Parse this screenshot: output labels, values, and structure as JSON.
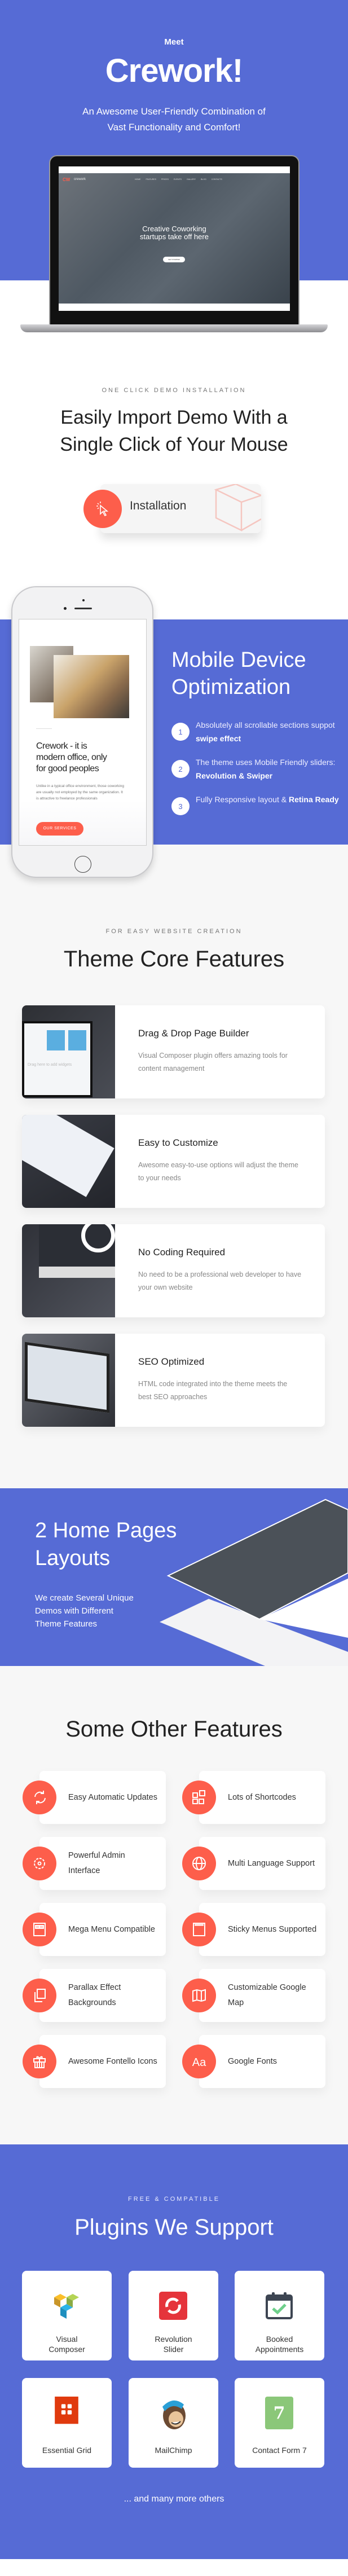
{
  "colors": {
    "brand_blue": "#566bd5",
    "accent_coral": "#fd5e4b",
    "section_gray": "#f7f7f7"
  },
  "hero": {
    "meet": "Meet",
    "title": "Crework!",
    "subtitle_lines": [
      "An Awesome User-Friendly Combination of",
      "Vast Functionality and Comfort!"
    ],
    "laptop_screen": {
      "logo_mark": "CW",
      "logo_text": "crework",
      "nav": [
        "HOME",
        "FEATURES",
        "PRICES",
        "EVENTS",
        "GALLERY",
        "BLOG",
        "CONTACTS"
      ],
      "headline_lines": [
        "Creative Coworking",
        "startups take off here"
      ],
      "cta": "GET STARTED"
    }
  },
  "demo": {
    "eyebrow": "ONE CLICK DEMO INSTALLATION",
    "title_lines": [
      "Easily Import Demo With a",
      "Single Click of Your Mouse"
    ],
    "button_label": "Installation",
    "button_icon": "cursor-click-icon"
  },
  "mobile": {
    "phone": {
      "heading_lines": [
        "Crework - it is",
        "modern office, only",
        "for good peoples"
      ],
      "body": "Unlike in a typical office environment, those coworking are usually not employed by the same organization. It is attractive to freelance professionals",
      "button": "OUR SERVICES"
    },
    "title_lines": [
      "Mobile Device",
      "Optimization"
    ],
    "items": [
      {
        "num": "1",
        "text": "Absolutely all scrollable sections suppot ",
        "bold": "swipe effect"
      },
      {
        "num": "2",
        "text": "The theme uses Mobile Friendly sliders: ",
        "bold": "Revolution & Swiper"
      },
      {
        "num": "3",
        "text": "Fully Responsive layout & ",
        "bold": "Retina Ready"
      }
    ]
  },
  "core": {
    "eyebrow": "FOR EASY WEBSITE CREATION",
    "title": "Theme Core Features",
    "cards": [
      {
        "title": "Drag & Drop Page Builder",
        "desc": "Visual Composer plugin offers amazing tools for content management",
        "image_caption": "Drag here to add widgets"
      },
      {
        "title": "Easy to Customize",
        "desc": "Awesome easy-to-use options will adjust the theme to your needs"
      },
      {
        "title": "No Coding Required",
        "desc": "No need to be a professional web developer to have your own website"
      },
      {
        "title": "SEO Optimized",
        "desc": "HTML code integrated into the theme meets the best SEO approaches"
      }
    ]
  },
  "layouts": {
    "title_lines": [
      "2 Home Pages",
      "Layouts"
    ],
    "desc_lines": [
      "We create Several Unique",
      "Demos with Different",
      "Theme Features"
    ]
  },
  "other": {
    "title": "Some Other Features",
    "items": [
      {
        "label": "Easy Automatic Updates",
        "icon": "refresh-icon"
      },
      {
        "label": "Lots of Shortcodes",
        "icon": "shortcodes-grid-icon"
      },
      {
        "label": "Powerful Admin Interface",
        "icon": "gear-icon"
      },
      {
        "label": "Multi Language Support",
        "icon": "globe-icon"
      },
      {
        "label": "Mega Menu Compatible",
        "icon": "mega-menu-icon"
      },
      {
        "label": "Sticky Menus Supported",
        "icon": "sticky-menu-icon"
      },
      {
        "label": "Parallax Effect Backgrounds",
        "icon": "layers-icon"
      },
      {
        "label": "Customizable Google Map",
        "icon": "map-icon"
      },
      {
        "label": "Awesome Fontello Icons",
        "icon": "gift-icon"
      },
      {
        "label": "Google Fonts",
        "icon": "font-aa-icon"
      }
    ]
  },
  "plugins": {
    "eyebrow": "FREE & COMPATIBLE",
    "title": "Plugins We Support",
    "items": [
      {
        "name_lines": [
          "Visual",
          "Composer"
        ],
        "icon": "visual-composer-logo"
      },
      {
        "name_lines": [
          "Revolution",
          "Slider"
        ],
        "icon": "revolution-slider-logo"
      },
      {
        "name_lines": [
          "Booked",
          "Appointments"
        ],
        "icon": "calendar-check-icon"
      },
      {
        "name_lines": [
          "Essential Grid"
        ],
        "icon": "essential-grid-logo"
      },
      {
        "name_lines": [
          "MailChimp"
        ],
        "icon": "mailchimp-logo"
      },
      {
        "name_lines": [
          "Contact Form 7"
        ],
        "icon": "contact-form-7-logo",
        "badge": "7"
      }
    ],
    "footer": "... and many more others"
  }
}
